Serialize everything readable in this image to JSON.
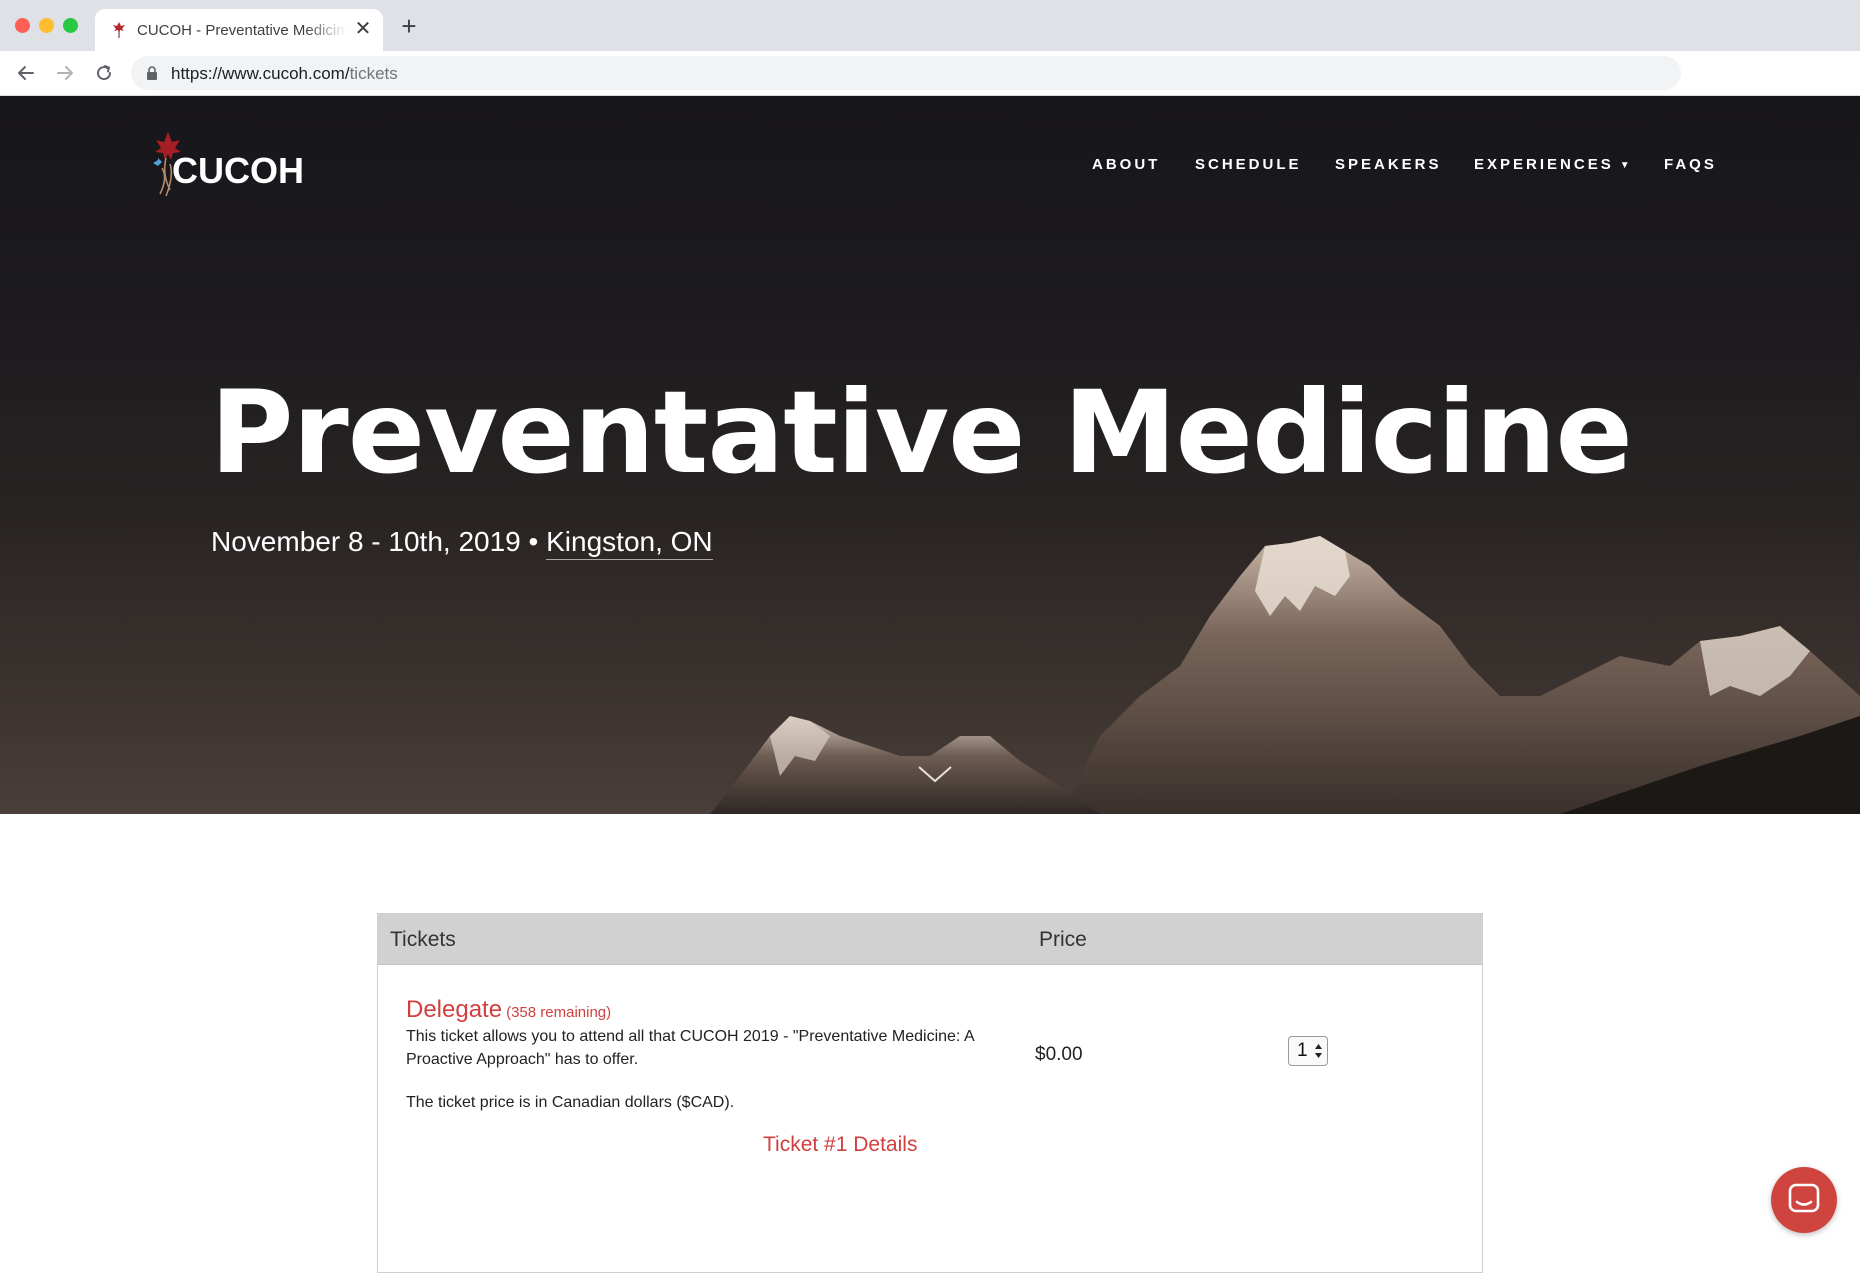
{
  "browser": {
    "tab_title": "CUCOH - Preventative Medicine",
    "url_base": "https://www.cucoh.com/",
    "url_path": "tickets",
    "close_glyph": "✕",
    "new_tab_glyph": "+"
  },
  "site": {
    "logo_text": "CUCOH",
    "nav": {
      "about": "ABOUT",
      "schedule": "SCHEDULE",
      "speakers": "SPEAKERS",
      "experiences": "EXPERIENCES",
      "faqs": "FAQS"
    }
  },
  "hero": {
    "title": "Preventative Medicine",
    "dates": "November 8 - 10th, 2019",
    "separator": " • ",
    "location": "Kingston, ON"
  },
  "tickets": {
    "header_tickets": "Tickets",
    "header_price": "Price",
    "items": [
      {
        "name": "Delegate",
        "remaining": "(358 remaining)",
        "description": "This ticket allows you to attend all that CUCOH 2019 - \"Preventative Medicine: A Proactive Approach\" has to offer.",
        "note": "The ticket price is in Canadian dollars ($CAD).",
        "price": "$0.00",
        "quantity": "1",
        "details_link": "Ticket #1 Details"
      }
    ]
  },
  "colors": {
    "accent": "#d13f3f",
    "chat_widget": "#d0443f",
    "table_header": "#d1d1d1"
  },
  "icons": [
    "back-arrow-icon",
    "forward-arrow-icon",
    "reload-icon",
    "lock-icon",
    "caret-down-icon",
    "chevron-down-icon",
    "chat-icon"
  ]
}
